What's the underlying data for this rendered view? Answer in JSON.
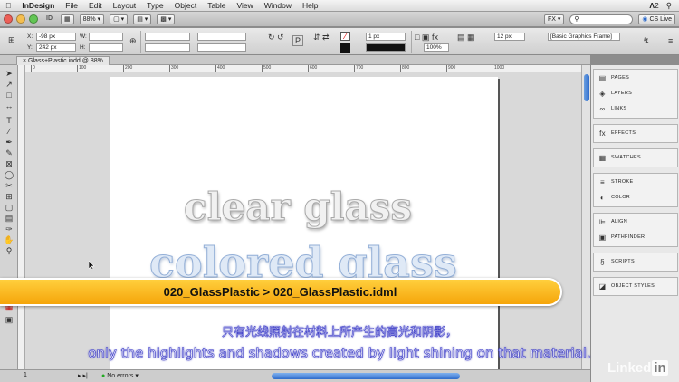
{
  "menubar": {
    "apple": "",
    "app": "InDesign",
    "items": [
      "File",
      "Edit",
      "Layout",
      "Type",
      "Object",
      "Table",
      "View",
      "Window",
      "Help"
    ],
    "right_badge": "2",
    "battery": "⚡"
  },
  "appbar": {
    "logo": "ID",
    "zoom": "88%",
    "workspace": "FX",
    "cs_live": "CS Live",
    "search_placeholder": ""
  },
  "control": {
    "x_label": "X:",
    "x_value": "-98 px",
    "y_label": "Y:",
    "y_value": "242 px",
    "w_label": "W:",
    "h_label": "H:",
    "stroke_weight": "1 px",
    "scale_pct": "100%",
    "spacing": "12 px",
    "object_style": "[Basic Graphics Frame]"
  },
  "document_tab": {
    "label": "Glass+Plastic.indd @ 88%"
  },
  "ruler": {
    "ticks": [
      "0",
      "100",
      "200",
      "300",
      "400",
      "500",
      "600",
      "700",
      "800",
      "900",
      "1000"
    ]
  },
  "canvas": {
    "line1": "clear glass",
    "line2": "colored glass"
  },
  "status": {
    "page": "1",
    "errors": "No errors"
  },
  "panels": [
    {
      "group": [
        {
          "icon": "pages-icon",
          "glyph": "▤",
          "label": "PAGES"
        },
        {
          "icon": "layers-icon",
          "glyph": "◈",
          "label": "LAYERS"
        },
        {
          "icon": "links-icon",
          "glyph": "∞",
          "label": "LINKS"
        }
      ]
    },
    {
      "group": [
        {
          "icon": "effects-icon",
          "glyph": "fx",
          "label": "EFFECTS"
        }
      ]
    },
    {
      "group": [
        {
          "icon": "swatches-icon",
          "glyph": "▦",
          "label": "SWATCHES"
        }
      ]
    },
    {
      "group": [
        {
          "icon": "stroke-icon",
          "glyph": "≡",
          "label": "STROKE"
        },
        {
          "icon": "color-icon",
          "glyph": "◐",
          "label": "COLOR"
        }
      ]
    },
    {
      "group": [
        {
          "icon": "align-icon",
          "glyph": "⊫",
          "label": "ALIGN"
        },
        {
          "icon": "pathfinder-icon",
          "glyph": "▣",
          "label": "PATHFINDER"
        }
      ]
    },
    {
      "group": [
        {
          "icon": "scripts-icon",
          "glyph": "§",
          "label": "SCRIPTS"
        }
      ]
    },
    {
      "group": [
        {
          "icon": "object-styles-icon",
          "glyph": "◪",
          "label": "OBJECT STYLES"
        }
      ]
    }
  ],
  "banner": {
    "text": "020_GlassPlastic > 020_GlassPlastic.idml"
  },
  "subtitles": {
    "cn": "只有光线照射在材料上所产生的高光和阴影，",
    "en": "only the highlights and shadows  created by light shining on that material."
  },
  "watermark": {
    "brand": "Linked",
    "brand_box": "in"
  },
  "colors": {
    "banner": "#f5a50a",
    "subtitle_stroke": "#3c3cc8",
    "scroll_thumb": "#2f6ccc"
  }
}
